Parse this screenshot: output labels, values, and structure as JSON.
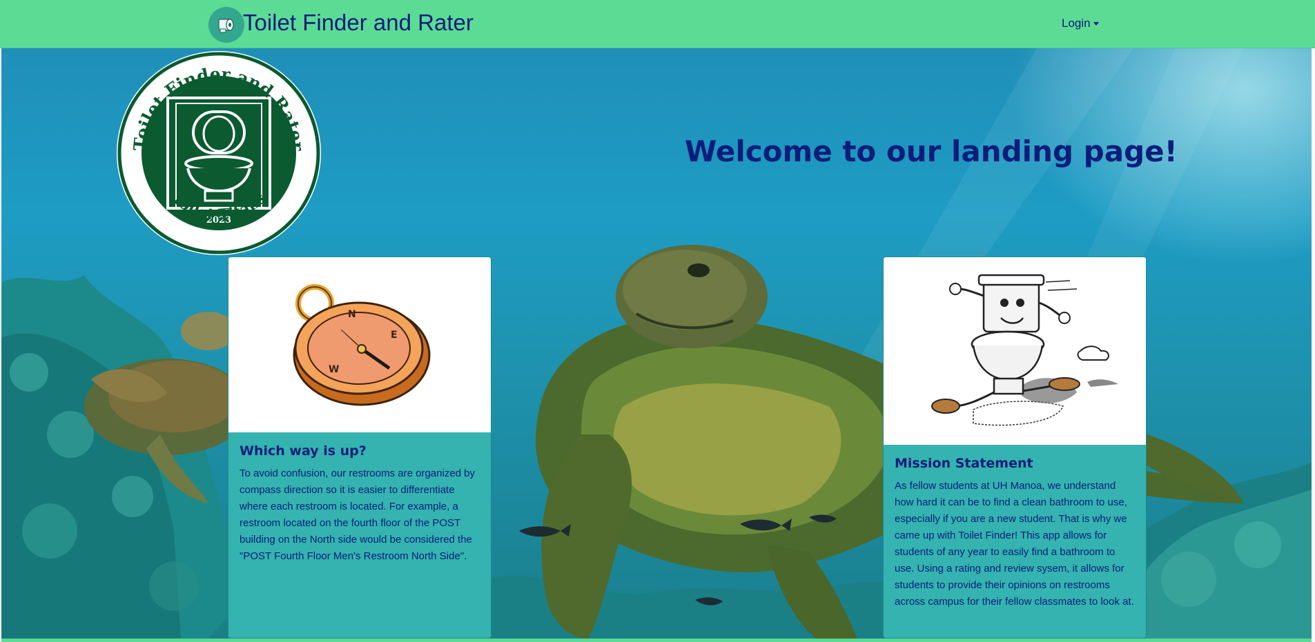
{
  "navbar": {
    "brand_title": "Toilet Finder and Rater",
    "brand_icon": "toilet-paper-icon",
    "login_label": "Login"
  },
  "logo": {
    "top_text": "Toilet Finder and Rater",
    "year": "2023",
    "bottom_text": "Toilet Titans",
    "icon": "toilet-icon"
  },
  "hero": {
    "welcome": "Welcome to our landing page!"
  },
  "cards": [
    {
      "image": "compass-icon",
      "title": "Which way is up?",
      "text": "To avoid confusion, our restrooms are organized by compass direction so it is easier to differentiate where each restroom is located. For example, a restroom located on the fourth floor of the POST building on the North side would be considered the \"POST Fourth Floor Men's Restroom North Side\"."
    },
    {
      "image": "running-toilet-icon",
      "title": "Mission Statement",
      "text": "As fellow students at UH Manoa, we understand how hard it can be to find a clean bathroom to use, especially if you are a new student. That is why we came up with Toilet Finder! This app allows for students of any year to easily find a bathroom to use. Using a rating and review sysem, it allows for students to provide their opinions on restrooms across campus for their fellow classmates to look at."
    }
  ],
  "colors": {
    "navbar_bg": "#5cdb95",
    "text_primary": "#0b1d7a",
    "card_bg": "#34b3b0",
    "logo_green": "#0b5a30"
  }
}
